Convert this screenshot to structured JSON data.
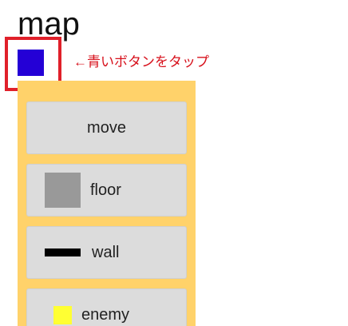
{
  "page": {
    "title": "map"
  },
  "hint": {
    "text": "←青いボタンをタップ"
  },
  "colors": {
    "blue_button": "#2400d6",
    "highlight_border": "#e0202a",
    "hint_text": "#d7101b",
    "panel_background": "#ffd26a",
    "button_background": "#dcdcdc",
    "floor_swatch": "#999999",
    "wall_swatch": "#000000",
    "enemy_swatch": "#ffff33"
  },
  "panel": {
    "buttons": [
      {
        "label": "move"
      },
      {
        "label": "floor",
        "icon": "floor-swatch"
      },
      {
        "label": "wall",
        "icon": "wall-swatch"
      },
      {
        "label": "enemy",
        "icon": "enemy-swatch"
      }
    ]
  }
}
